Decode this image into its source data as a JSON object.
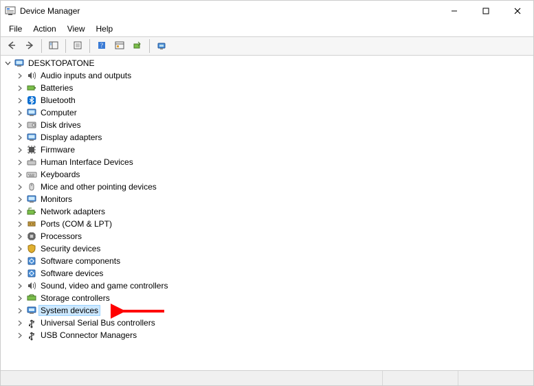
{
  "window": {
    "title": "Device Manager"
  },
  "menus": {
    "file": "File",
    "action": "Action",
    "view": "View",
    "help": "Help"
  },
  "tree": {
    "root": "DESKTOPATONE",
    "categories": [
      {
        "id": "audio",
        "label": "Audio inputs and outputs",
        "icon": "speaker",
        "selected": false
      },
      {
        "id": "batteries",
        "label": "Batteries",
        "icon": "battery",
        "selected": false
      },
      {
        "id": "bluetooth",
        "label": "Bluetooth",
        "icon": "bluetooth",
        "selected": false
      },
      {
        "id": "computer",
        "label": "Computer",
        "icon": "monitor",
        "selected": false
      },
      {
        "id": "disk",
        "label": "Disk drives",
        "icon": "disk",
        "selected": false
      },
      {
        "id": "display",
        "label": "Display adapters",
        "icon": "monitor",
        "selected": false
      },
      {
        "id": "firmware",
        "label": "Firmware",
        "icon": "chip",
        "selected": false
      },
      {
        "id": "hid",
        "label": "Human Interface Devices",
        "icon": "hid",
        "selected": false
      },
      {
        "id": "keyboards",
        "label": "Keyboards",
        "icon": "keyboard",
        "selected": false
      },
      {
        "id": "mice",
        "label": "Mice and other pointing devices",
        "icon": "mouse",
        "selected": false
      },
      {
        "id": "monitors",
        "label": "Monitors",
        "icon": "monitor",
        "selected": false
      },
      {
        "id": "network",
        "label": "Network adapters",
        "icon": "network",
        "selected": false
      },
      {
        "id": "ports",
        "label": "Ports (COM & LPT)",
        "icon": "port",
        "selected": false
      },
      {
        "id": "processors",
        "label": "Processors",
        "icon": "cpu",
        "selected": false
      },
      {
        "id": "security",
        "label": "Security devices",
        "icon": "shield",
        "selected": false
      },
      {
        "id": "swcomp",
        "label": "Software components",
        "icon": "sw",
        "selected": false
      },
      {
        "id": "swdev",
        "label": "Software devices",
        "icon": "sw",
        "selected": false
      },
      {
        "id": "sound",
        "label": "Sound, video and game controllers",
        "icon": "speaker",
        "selected": false
      },
      {
        "id": "storage",
        "label": "Storage controllers",
        "icon": "storage",
        "selected": false
      },
      {
        "id": "system",
        "label": "System devices",
        "icon": "system",
        "selected": true
      },
      {
        "id": "usb",
        "label": "Universal Serial Bus controllers",
        "icon": "usb",
        "selected": false
      },
      {
        "id": "usbconn",
        "label": "USB Connector Managers",
        "icon": "usb",
        "selected": false
      }
    ]
  },
  "annotation": {
    "color": "#ff0000"
  }
}
